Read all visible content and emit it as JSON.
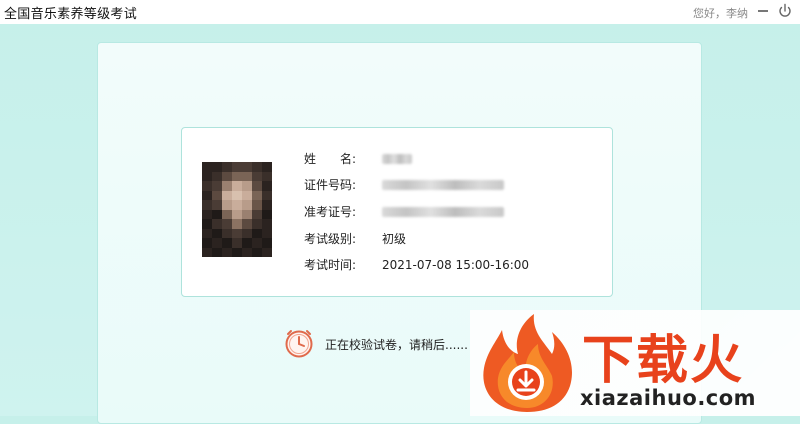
{
  "window": {
    "title": "全国音乐素养等级考试",
    "greeting": "您好，李纳",
    "min_symbol": "—",
    "power_icon": "power-icon"
  },
  "candidate": {
    "photo": "candidate-photo",
    "fields": [
      {
        "label": "姓　　名:",
        "value": "",
        "redacted": true
      },
      {
        "label": "证件号码:",
        "value": "",
        "redacted": true
      },
      {
        "label": "准考证号:",
        "value": "",
        "redacted": true
      },
      {
        "label": "考试级别:",
        "value": "初级",
        "redacted": false
      },
      {
        "label": "考试时间:",
        "value": "2021-07-08 15:00-16:00",
        "redacted": false
      }
    ]
  },
  "status": {
    "icon": "clock-icon",
    "text": "正在校验试卷，请稍后......"
  },
  "watermark": {
    "brand": "下载火",
    "url": "xiazaihuo.com"
  },
  "colors": {
    "background": "#c6f0ea",
    "panel": "#eefbfa",
    "card_border": "#aee3dc",
    "clock": "#e06a4c",
    "watermark_red": "#e8421c"
  }
}
